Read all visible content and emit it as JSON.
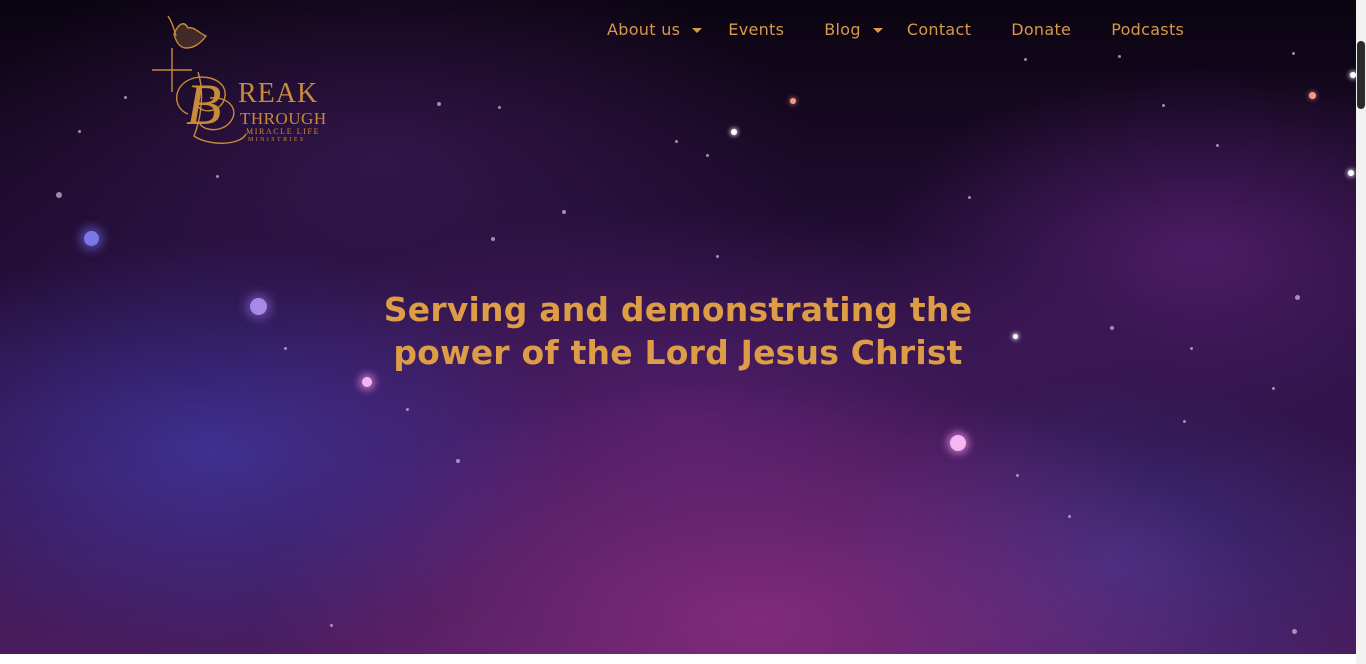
{
  "logo": {
    "line1": "REAK",
    "line2": "THROUGH",
    "line3": "MIRACLE LIFE",
    "line4": "MINISTRIES",
    "monogram": "B",
    "color": "#c98a3a"
  },
  "nav": {
    "items": [
      {
        "label": "About us",
        "has_dropdown": true
      },
      {
        "label": "Events",
        "has_dropdown": false
      },
      {
        "label": "Blog",
        "has_dropdown": true
      },
      {
        "label": "Contact",
        "has_dropdown": false
      },
      {
        "label": "Donate",
        "has_dropdown": false
      },
      {
        "label": "Podcasts",
        "has_dropdown": false
      }
    ],
    "color": "#d7994a"
  },
  "hero": {
    "headline_line1": "Serving and demonstrating the",
    "headline_line2": "power of the Lord Jesus Christ",
    "headline_color": "#dd9d46",
    "background": "night-sky-galaxy"
  }
}
